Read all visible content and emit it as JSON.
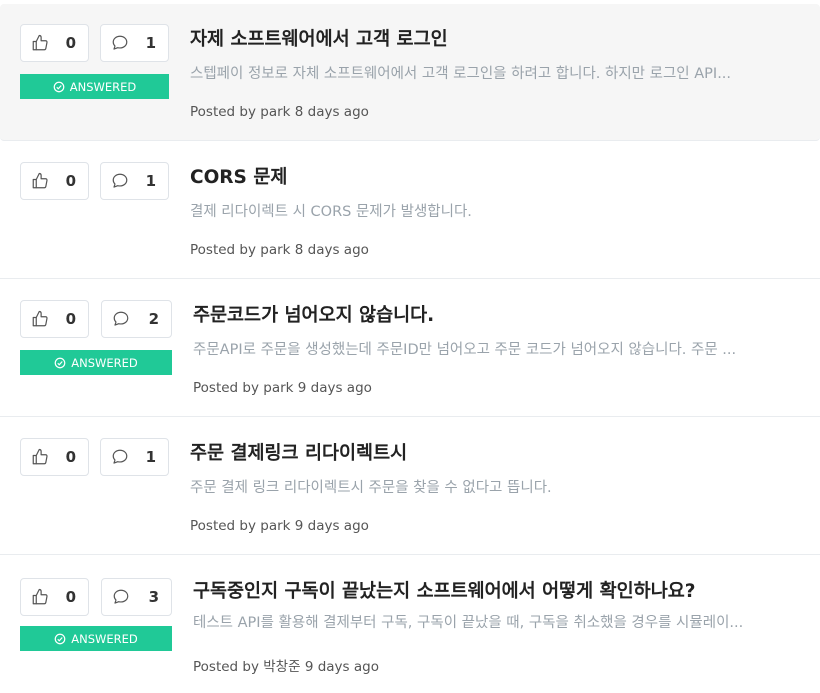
{
  "answered_label": "ANSWERED",
  "posts": [
    {
      "likes": "0",
      "comments": "1",
      "answered": true,
      "title": "자제 소프트웨어에서 고객 로그인",
      "excerpt": "스텝페이 정보로 자체 소프트웨어에서 고객 로그인을 하려고 합니다. 하지만 로그인 API...",
      "meta": "Posted by park 8 days ago"
    },
    {
      "likes": "0",
      "comments": "1",
      "answered": false,
      "title": "CORS 문제",
      "excerpt": "결제 리다이렉트 시 CORS 문제가 발생합니다.",
      "meta": "Posted by park 8 days ago"
    },
    {
      "likes": "0",
      "comments": "2",
      "answered": true,
      "title": "주문코드가 넘어오지 않습니다.",
      "excerpt": "주문API로 주문을 생성했는데 주문ID만 넘어오고 주문 코드가 넘어오지 않습니다. 주문 ...",
      "meta": "Posted by park 9 days ago"
    },
    {
      "likes": "0",
      "comments": "1",
      "answered": false,
      "title": "주문 결제링크 리다이렉트시",
      "excerpt": "주문 결제 링크 리다이렉트시 주문을 찾을 수 없다고 뜹니다.",
      "meta": "Posted by park 9 days ago"
    },
    {
      "likes": "0",
      "comments": "3",
      "answered": true,
      "title": "구독중인지 구독이 끝났는지 소프트웨어에서 어떻게 확인하나요?",
      "excerpt": "테스트 API를 활용해 결제부터 구독, 구독이 끝났을 때, 구독을 취소했을 경우를 시뮬레이...",
      "meta": "Posted by 박창준 9 days ago"
    }
  ]
}
